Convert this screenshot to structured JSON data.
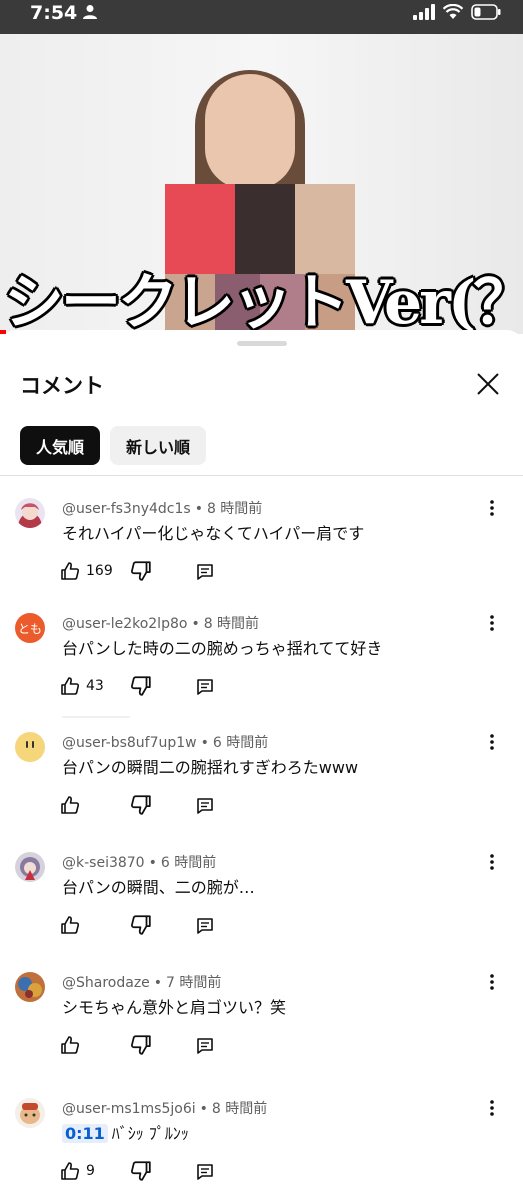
{
  "status_bar": {
    "time": "7:54",
    "battery_level": 0.3
  },
  "video": {
    "caption": "シークレットVer(？)"
  },
  "comments_panel": {
    "title": "コメント",
    "sort_chips": [
      {
        "label": "人気順",
        "active": true
      },
      {
        "label": "新しい順",
        "active": false
      }
    ],
    "comments": [
      {
        "author": "@user-fs3ny4dc1s",
        "time": "8 時間前",
        "text": "それハイパー化じゃなくてハイパー肩です",
        "likes": "169",
        "avatar": "avatar-anime",
        "avatar_color": "#b9a0c8"
      },
      {
        "author": "@user-le2ko2lp8o",
        "time": "8 時間前",
        "text": "台パンした時の二の腕めっちゃ揺れてて好き",
        "likes": "43",
        "avatar": "avatar-initials",
        "avatar_text": "とも",
        "avatar_color": "#ec5b2b"
      },
      {
        "author": "@user-bs8uf7up1w",
        "time": "6 時間前",
        "text": "台パンの瞬間二の腕揺れすぎわろたwww",
        "likes": "",
        "avatar": "avatar-face",
        "avatar_color": "#f5d67a"
      },
      {
        "author": "@k-sei3870",
        "time": "6 時間前",
        "text": "台パンの瞬間、二の腕が…",
        "likes": "",
        "avatar": "avatar-anime",
        "avatar_color": "#8a7aa0"
      },
      {
        "author": "@Sharodaze",
        "time": "7 時間前",
        "text": "シモちゃん意外と肩ゴツい？笑",
        "likes": "",
        "avatar": "avatar-art",
        "avatar_color": "#c0703a"
      },
      {
        "author": "@user-ms1ms5jo6i",
        "time": "8 時間前",
        "timestamp": "0:11",
        "text": "ﾊﾞｼｯ ﾌﾟﾙﾝｯ",
        "likes": "9",
        "avatar": "avatar-dog",
        "avatar_color": "#e8b88a"
      }
    ]
  }
}
